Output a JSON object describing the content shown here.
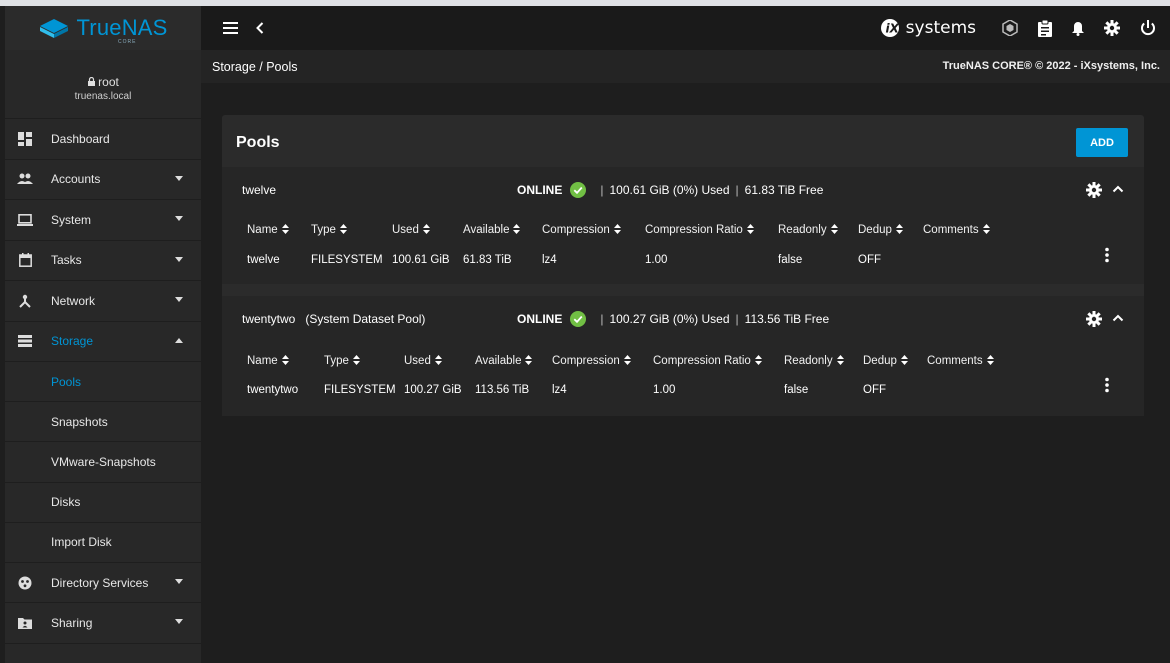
{
  "brand": {
    "name": "TrueNAS",
    "sub": "CORE",
    "color": "#0095d5"
  },
  "user": {
    "name": "root",
    "host": "truenas.local"
  },
  "nav": [
    {
      "key": "dashboard",
      "label": "Dashboard",
      "icon": "dashboard-icon",
      "chevron": "none"
    },
    {
      "key": "accounts",
      "label": "Accounts",
      "icon": "accounts-icon",
      "chevron": "down"
    },
    {
      "key": "system",
      "label": "System",
      "icon": "system-icon",
      "chevron": "down"
    },
    {
      "key": "tasks",
      "label": "Tasks",
      "icon": "tasks-icon",
      "chevron": "down"
    },
    {
      "key": "network",
      "label": "Network",
      "icon": "network-icon",
      "chevron": "down"
    },
    {
      "key": "storage",
      "label": "Storage",
      "icon": "storage-icon",
      "chevron": "up",
      "active": true
    }
  ],
  "storage_sub": [
    {
      "label": "Pools",
      "active": true
    },
    {
      "label": "Snapshots"
    },
    {
      "label": "VMware-Snapshots"
    },
    {
      "label": "Disks"
    },
    {
      "label": "Import Disk"
    }
  ],
  "nav_bottom": [
    {
      "key": "directory-services",
      "label": "Directory Services",
      "icon": "directory-services-icon",
      "chevron": "down"
    },
    {
      "key": "sharing",
      "label": "Sharing",
      "icon": "sharing-icon",
      "chevron": "down"
    }
  ],
  "topbar": {
    "vendor_logo": "systems"
  },
  "breadcrumb": {
    "path": "Storage / Pools",
    "copyright": "TrueNAS CORE® © 2022 - iXsystems, Inc."
  },
  "pools_card": {
    "title": "Pools",
    "add_label": "ADD"
  },
  "columns": [
    "Name",
    "Type",
    "Used",
    "Available",
    "Compression",
    "Compression Ratio",
    "Readonly",
    "Dedup",
    "Comments"
  ],
  "pools": [
    {
      "name": "twelve",
      "status": "ONLINE",
      "used_summary": "100.61 GiB (0%) Used",
      "free_summary": "61.83 TiB Free",
      "row": [
        "twelve",
        "FILESYSTEM",
        "100.61 GiB",
        "61.83 TiB",
        "lz4",
        "1.00",
        "false",
        "OFF",
        ""
      ]
    },
    {
      "name": "twentytwo   (System Dataset Pool)",
      "status": "ONLINE",
      "used_summary": "100.27 GiB (0%) Used",
      "free_summary": "113.56 TiB Free",
      "row": [
        "twentytwo",
        "FILESYSTEM",
        "100.27 GiB",
        "113.56 TiB",
        "lz4",
        "1.00",
        "false",
        "OFF",
        ""
      ]
    }
  ]
}
